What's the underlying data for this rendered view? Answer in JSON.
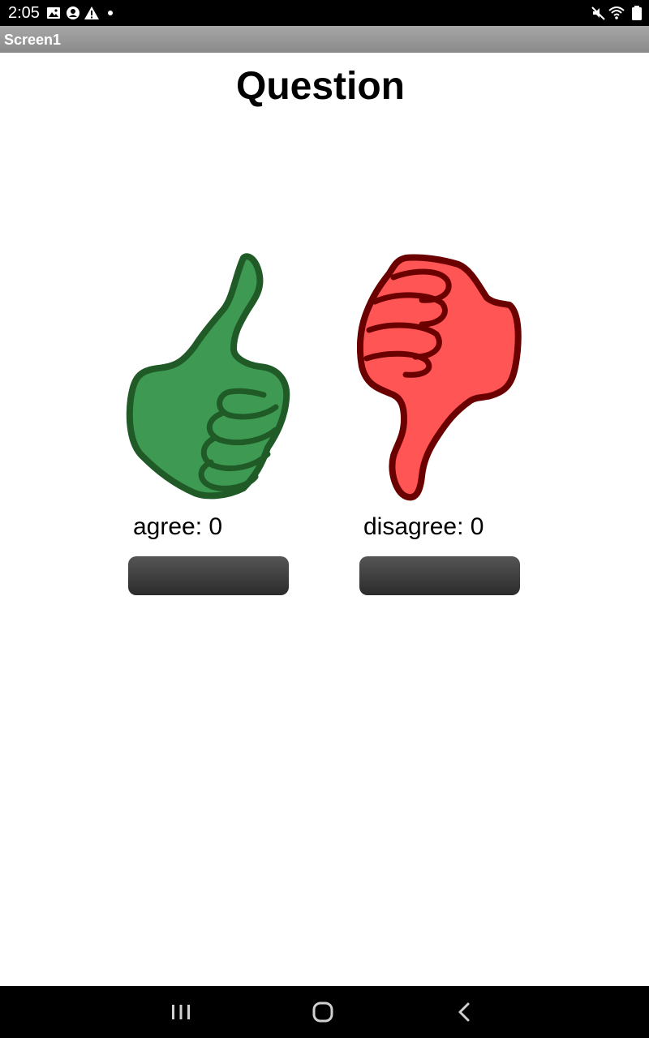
{
  "status_bar": {
    "time": "2:05",
    "left_icons": [
      "image-icon",
      "account-icon",
      "warning-icon",
      "dot-icon"
    ],
    "right_icons": [
      "mute-icon",
      "wifi-icon",
      "battery-icon"
    ]
  },
  "app": {
    "screen_title": "Screen1",
    "question": "Question"
  },
  "agree": {
    "label": "agree: 0",
    "icon": "thumbs-up-icon",
    "color": "#3e9a52",
    "outline": "#1f5a27"
  },
  "disagree": {
    "label": "disagree: 0",
    "icon": "thumbs-down-icon",
    "color": "#ff5555",
    "outline": "#6a0000"
  },
  "nav_bar": {
    "buttons": [
      "recent-apps-icon",
      "home-icon",
      "back-icon"
    ]
  }
}
